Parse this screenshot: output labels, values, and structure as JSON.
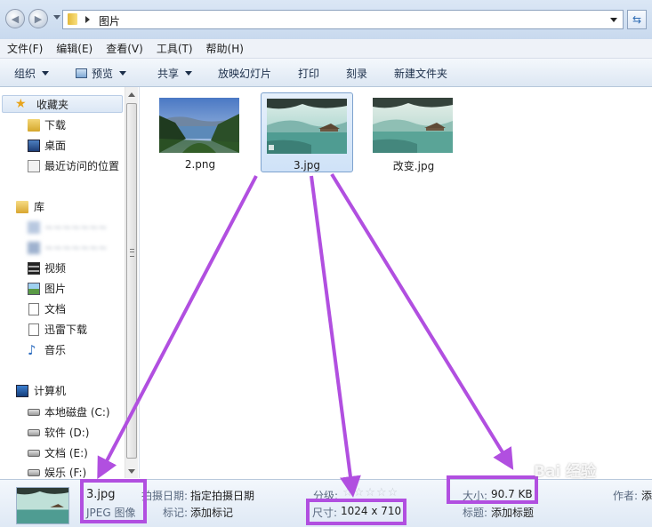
{
  "address": {
    "path": "图片"
  },
  "menu": [
    "文件(F)",
    "编辑(E)",
    "查看(V)",
    "工具(T)",
    "帮助(H)"
  ],
  "toolbar": {
    "organize": "组织",
    "preview": "预览",
    "share": "共享",
    "slideshow": "放映幻灯片",
    "print": "打印",
    "burn": "刻录",
    "new_folder": "新建文件夹"
  },
  "sidebar": {
    "favorites": "收藏夹",
    "downloads": "下载",
    "desktop": "桌面",
    "recent": "最近访问的位置",
    "libraries": "库",
    "blurred1": "~~~~~~~",
    "blurred2": "~~~~~~~",
    "videos": "视频",
    "pictures": "图片",
    "documents": "文档",
    "thunder": "迅雷下载",
    "music": "音乐",
    "computer": "计算机",
    "drive_c": "本地磁盘 (C:)",
    "drive_d": "软件 (D:)",
    "drive_e": "文档 (E:)",
    "drive_f": "娱乐 (F:)"
  },
  "files": [
    {
      "name": "2.png"
    },
    {
      "name": "3.jpg"
    },
    {
      "name": "改变.jpg"
    }
  ],
  "details": {
    "filename": "3.jpg",
    "filetype": "JPEG 图像",
    "date_taken_label": "拍摄日期:",
    "date_taken_value": "指定拍摄日期",
    "tags_label": "标记:",
    "tags_value": "添加标记",
    "rating_label": "分级:",
    "rating_stars": "☆☆☆☆☆",
    "dimensions_label": "尺寸:",
    "dimensions_value": "1024 x 710",
    "size_label": "大小:",
    "size_value": "90.7 KB",
    "title_label": "标题:",
    "title_value": "添加标题",
    "author_label": "作者:",
    "author_value": "添"
  },
  "watermark": "Bai 经验",
  "colors": {
    "highlight": "#b14fe0",
    "selection": "#cfe2f8"
  }
}
